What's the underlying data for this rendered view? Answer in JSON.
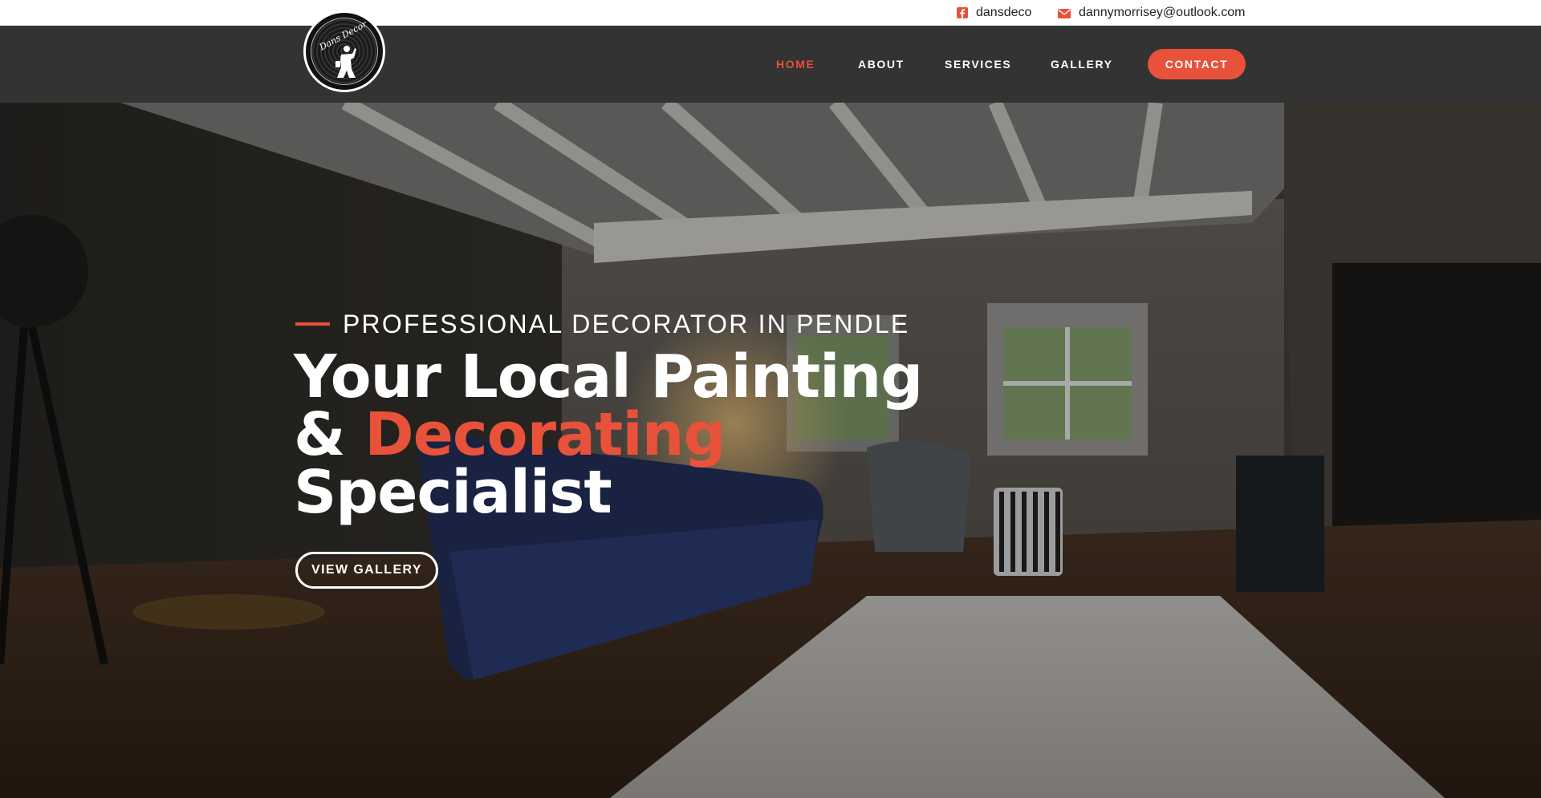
{
  "topbar": {
    "facebook": {
      "icon": "facebook-square-icon",
      "label": "dansdeco"
    },
    "email": {
      "icon": "envelope-icon",
      "label": "dannymorrisey@outlook.com"
    }
  },
  "logo": {
    "text": "Dans Decor",
    "icon": "painter-figure-icon"
  },
  "nav": {
    "home": "HOME",
    "about": "ABOUT",
    "services": "SERVICES",
    "gallery": "GALLERY",
    "contact": "CONTACT",
    "active": "HOME"
  },
  "hero": {
    "eyebrow": "PROFESSIONAL DECORATOR IN PENDLE",
    "headline_line1": "Your Local Painting",
    "headline_amp": "& ",
    "headline_accent": "Decorating",
    "headline_line3": "Specialist",
    "cta": "VIEW GALLERY"
  },
  "colors": {
    "accent": "#e8513a",
    "nav_bg": "#333333",
    "topbar_bg": "#ffffff",
    "text_light": "#ffffff"
  }
}
